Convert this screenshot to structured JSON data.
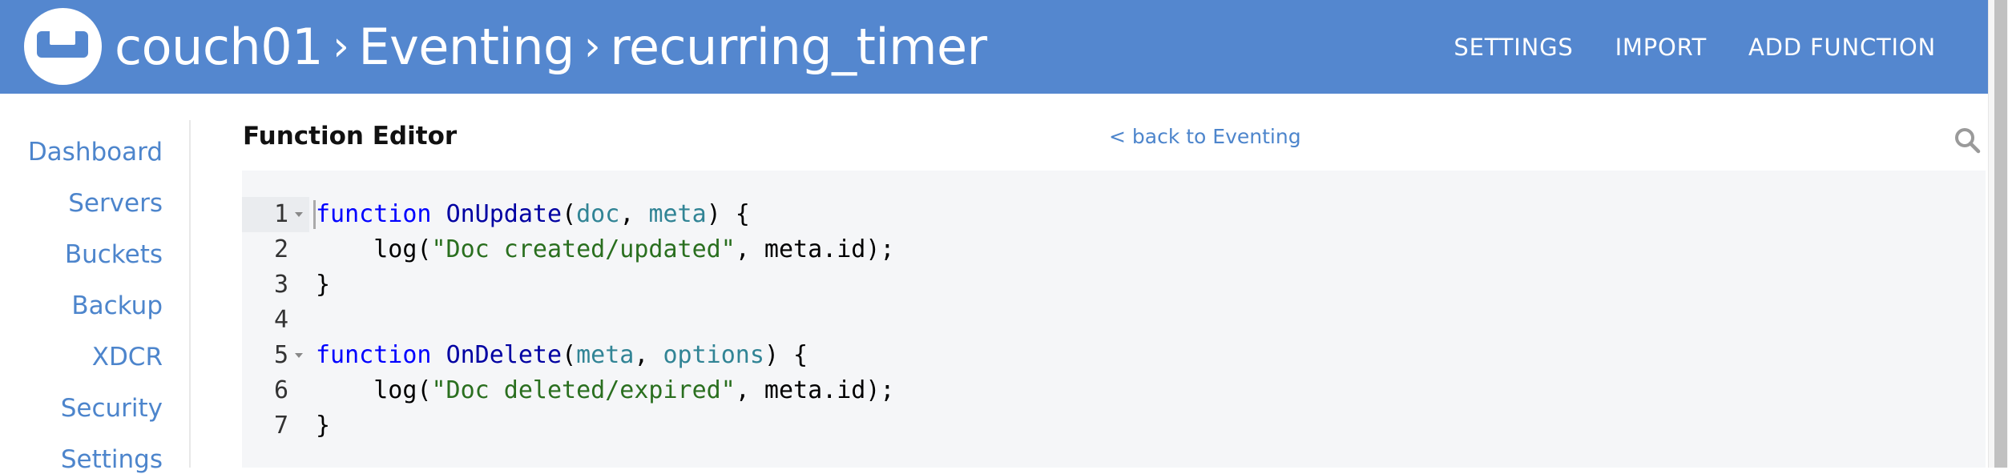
{
  "header": {
    "logo": "couchbase-logo-icon",
    "breadcrumb": [
      "couch01",
      "Eventing",
      "recurring_timer"
    ],
    "separator": "›",
    "nav": [
      {
        "label": "SETTINGS"
      },
      {
        "label": "IMPORT"
      },
      {
        "label": "ADD FUNCTION"
      }
    ],
    "color": "#5487cf"
  },
  "sidebar": {
    "items": [
      {
        "label": "Dashboard"
      },
      {
        "label": "Servers"
      },
      {
        "label": "Buckets"
      },
      {
        "label": "Backup"
      },
      {
        "label": "XDCR"
      },
      {
        "label": "Security"
      },
      {
        "label": "Settings"
      }
    ]
  },
  "editor": {
    "title": "Function Editor",
    "back_link": "< back to Eventing",
    "search_icon": "search-icon",
    "active_line": 1,
    "lines": [
      {
        "n": "1",
        "fold": true,
        "tokens": [
          [
            "kw",
            "function"
          ],
          [
            "plain",
            " "
          ],
          [
            "fn",
            "OnUpdate"
          ],
          [
            "plain",
            "("
          ],
          [
            "param",
            "doc"
          ],
          [
            "plain",
            ", "
          ],
          [
            "param",
            "meta"
          ],
          [
            "plain",
            ") {"
          ]
        ]
      },
      {
        "n": "2",
        "fold": false,
        "tokens": [
          [
            "plain",
            "    log("
          ],
          [
            "str",
            "\"Doc created/updated\""
          ],
          [
            "plain",
            ", meta.id);"
          ]
        ]
      },
      {
        "n": "3",
        "fold": false,
        "tokens": [
          [
            "plain",
            "}"
          ]
        ]
      },
      {
        "n": "4",
        "fold": false,
        "tokens": []
      },
      {
        "n": "5",
        "fold": true,
        "tokens": [
          [
            "kw",
            "function"
          ],
          [
            "plain",
            " "
          ],
          [
            "fn",
            "OnDelete"
          ],
          [
            "plain",
            "("
          ],
          [
            "param",
            "meta"
          ],
          [
            "plain",
            ", "
          ],
          [
            "param",
            "options"
          ],
          [
            "plain",
            ") {"
          ]
        ]
      },
      {
        "n": "6",
        "fold": false,
        "tokens": [
          [
            "plain",
            "    log("
          ],
          [
            "str",
            "\"Doc deleted/expired\""
          ],
          [
            "plain",
            ", meta.id);"
          ]
        ]
      },
      {
        "n": "7",
        "fold": false,
        "tokens": [
          [
            "plain",
            "}"
          ]
        ]
      }
    ]
  }
}
